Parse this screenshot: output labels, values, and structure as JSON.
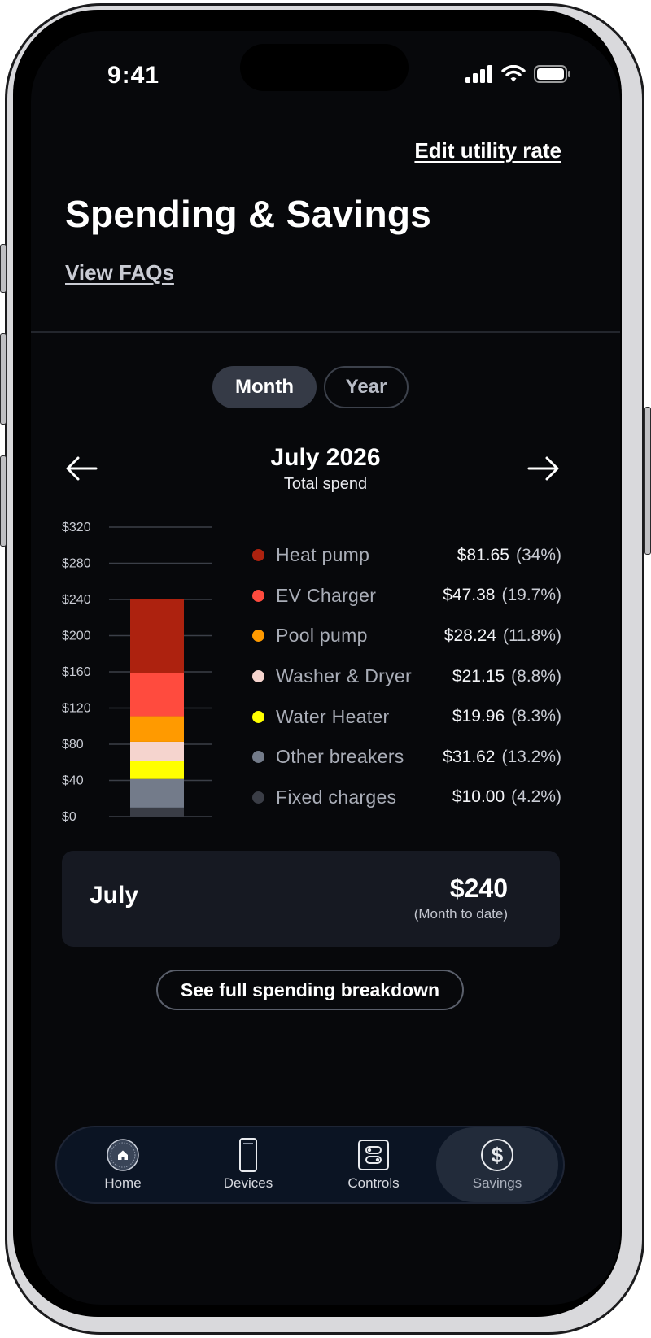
{
  "status": {
    "time": "9:41"
  },
  "header": {
    "edit_rate_label": "Edit utility rate",
    "title": "Spending & Savings",
    "faqs_label": "View FAQs"
  },
  "toggle": {
    "month_label": "Month",
    "year_label": "Year",
    "selected": "Month"
  },
  "period": {
    "title": "July 2026",
    "subtitle": "Total spend"
  },
  "chart_data": {
    "type": "bar",
    "stacked": true,
    "categories": [
      "July 2026"
    ],
    "ylim": [
      0,
      320
    ],
    "yticks": [
      0,
      40,
      80,
      120,
      160,
      200,
      240,
      280,
      320
    ],
    "ytick_labels": [
      "$0",
      "$40",
      "$80",
      "$120",
      "$160",
      "$200",
      "$240",
      "$280",
      "$320"
    ],
    "grid": true,
    "series": [
      {
        "name": "Fixed charges",
        "values": [
          10.0
        ],
        "color": "#3a3d46"
      },
      {
        "name": "Other breakers",
        "values": [
          31.62
        ],
        "color": "#737b8a"
      },
      {
        "name": "Water Heater",
        "values": [
          19.96
        ],
        "color": "#ffff00"
      },
      {
        "name": "Washer & Dryer",
        "values": [
          21.15
        ],
        "color": "#f5d4ce"
      },
      {
        "name": "Pool pump",
        "values": [
          28.24
        ],
        "color": "#ff9a00"
      },
      {
        "name": "EV Charger",
        "values": [
          47.38
        ],
        "color": "#ff4b3e"
      },
      {
        "name": "Heat pump",
        "values": [
          81.65
        ],
        "color": "#ad220f"
      }
    ]
  },
  "legend": [
    {
      "name": "Heat pump",
      "value": "$81.65",
      "pct": "(34%)",
      "color": "#ad220f"
    },
    {
      "name": "EV Charger",
      "value": "$47.38",
      "pct": "(19.7%)",
      "color": "#ff4b3e"
    },
    {
      "name": "Pool pump",
      "value": "$28.24",
      "pct": "(11.8%)",
      "color": "#ff9a00"
    },
    {
      "name": "Washer & Dryer",
      "value": "$21.15",
      "pct": "(8.8%)",
      "color": "#f5d4ce"
    },
    {
      "name": "Water Heater",
      "value": "$19.96",
      "pct": "(8.3%)",
      "color": "#ffff00"
    },
    {
      "name": "Other breakers",
      "value": "$31.62",
      "pct": "(13.2%)",
      "color": "#737b8a"
    },
    {
      "name": "Fixed charges",
      "value": "$10.00",
      "pct": "(4.2%)",
      "color": "#3a3d46"
    }
  ],
  "summary": {
    "month": "July",
    "amount": "$240",
    "note": "(Month to date)"
  },
  "breakdown_button": "See full spending breakdown",
  "nav": {
    "items": [
      {
        "label": "Home",
        "icon": "home-icon"
      },
      {
        "label": "Devices",
        "icon": "devices-icon"
      },
      {
        "label": "Controls",
        "icon": "controls-icon"
      },
      {
        "label": "Savings",
        "icon": "dollar-icon"
      }
    ],
    "active": "Savings"
  }
}
